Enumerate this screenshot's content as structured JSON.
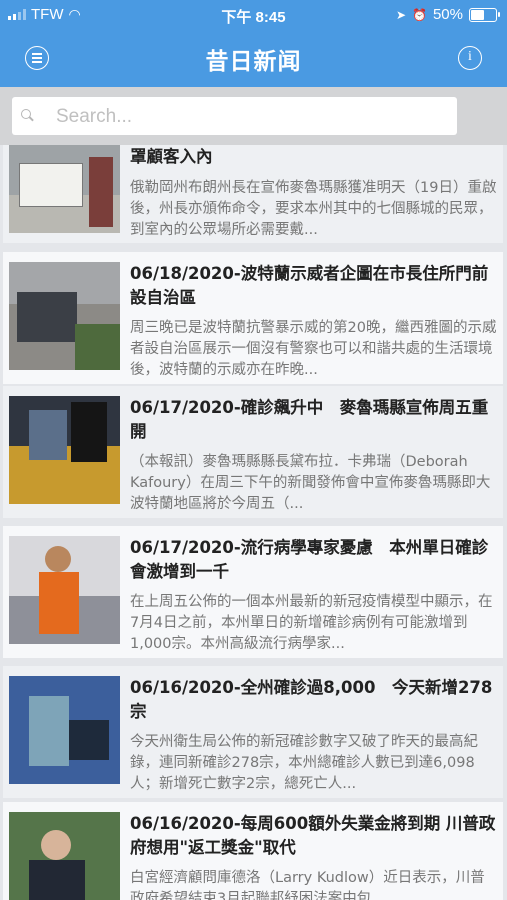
{
  "status": {
    "carrier": "TFW",
    "time": "下午 8:45",
    "battery_text": "50%",
    "battery_level": 0.5
  },
  "nav": {
    "title": "昔日新闻",
    "menu_icon": "menu-icon",
    "info_icon": "info-icon"
  },
  "search": {
    "placeholder": "Search...",
    "value": ""
  },
  "colors": {
    "accent": "#4a9ae2",
    "headline": "#222222",
    "summary": "#777777"
  },
  "articles": [
    {
      "title": "罩顧客入內",
      "summary": "俄勒岡州布朗州長在宣佈麥魯瑪縣獲准明天（19日）重啟後，州長亦頒佈命令，要求本州其中的七個縣城的民眾，到室內的公眾場所必需要戴..."
    },
    {
      "title": "06/18/2020-波特蘭示威者企圖在市長住所門前設自治區",
      "summary": "周三晚已是波特蘭抗警暴示威的第20晚，繼西雅圖的示威者設自治區展示一個沒有警察也可以和諧共處的生活環境後，波特蘭的示威亦在昨晚..."
    },
    {
      "title": "06/17/2020-確診飆升中　麥魯瑪縣宣佈周五重開",
      "summary": "（本報訊）麥魯瑪縣縣長黛布拉．卡弗瑞（Deborah Kafoury）在周三下午的新聞發佈會中宣佈麥魯瑪縣即大波特蘭地區將於今周五（..."
    },
    {
      "title": "06/17/2020-流行病學專家憂慮　本州單日確診會激增到一千",
      "summary": "在上周五公佈的一個本州最新的新冠疫情模型中顯示，在7月4日之前，本州單日的新增確診病例有可能激增到1,000宗。本州高級流行病學家..."
    },
    {
      "title": "06/16/2020-全州確診過8,000　今天新增278宗",
      "summary": "今天州衛生局公佈的新冠確診數字又破了昨天的最高紀錄，連同新確診278宗，本州總確診人數已到達6,098人；新增死亡數字2宗，總死亡人..."
    },
    {
      "title": "06/16/2020-每周600額外失業金將到期 川普政府想用\"返工獎金\"取代",
      "summary": "白宮經濟顧問庫德洛（Larry Kudlow）近日表示，川普政府希望結束3月起聯邦紓困法案中包..."
    }
  ]
}
